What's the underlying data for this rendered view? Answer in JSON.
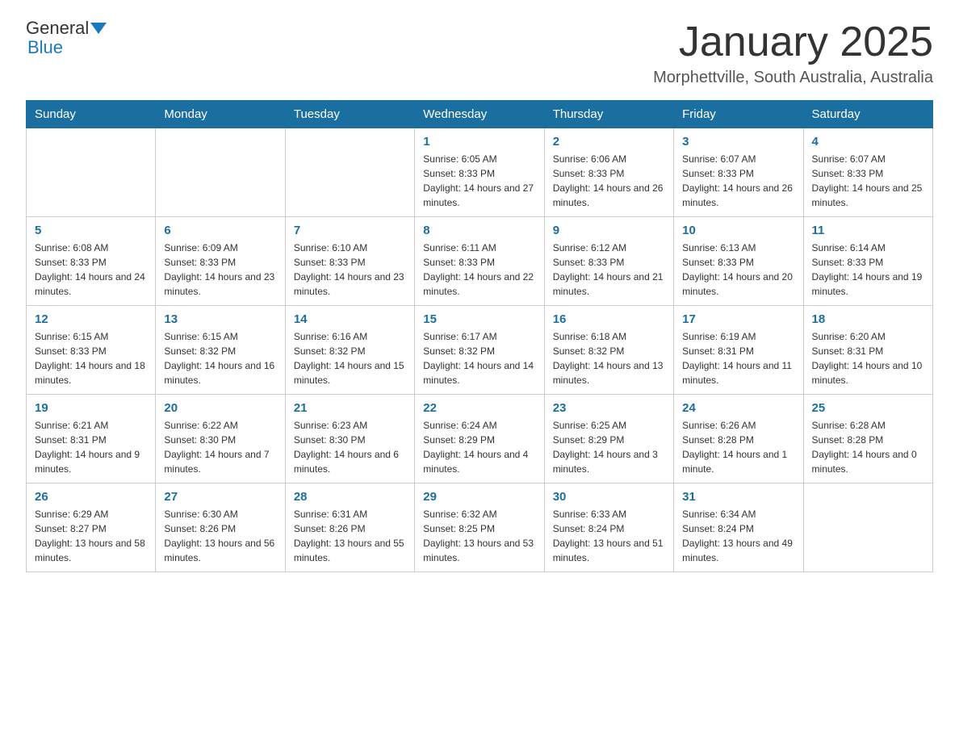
{
  "header": {
    "logo_general": "General",
    "logo_blue": "Blue",
    "month_title": "January 2025",
    "location": "Morphettville, South Australia, Australia"
  },
  "days_of_week": [
    "Sunday",
    "Monday",
    "Tuesday",
    "Wednesday",
    "Thursday",
    "Friday",
    "Saturday"
  ],
  "weeks": [
    [
      {
        "day": "",
        "info": ""
      },
      {
        "day": "",
        "info": ""
      },
      {
        "day": "",
        "info": ""
      },
      {
        "day": "1",
        "info": "Sunrise: 6:05 AM\nSunset: 8:33 PM\nDaylight: 14 hours and 27 minutes."
      },
      {
        "day": "2",
        "info": "Sunrise: 6:06 AM\nSunset: 8:33 PM\nDaylight: 14 hours and 26 minutes."
      },
      {
        "day": "3",
        "info": "Sunrise: 6:07 AM\nSunset: 8:33 PM\nDaylight: 14 hours and 26 minutes."
      },
      {
        "day": "4",
        "info": "Sunrise: 6:07 AM\nSunset: 8:33 PM\nDaylight: 14 hours and 25 minutes."
      }
    ],
    [
      {
        "day": "5",
        "info": "Sunrise: 6:08 AM\nSunset: 8:33 PM\nDaylight: 14 hours and 24 minutes."
      },
      {
        "day": "6",
        "info": "Sunrise: 6:09 AM\nSunset: 8:33 PM\nDaylight: 14 hours and 23 minutes."
      },
      {
        "day": "7",
        "info": "Sunrise: 6:10 AM\nSunset: 8:33 PM\nDaylight: 14 hours and 23 minutes."
      },
      {
        "day": "8",
        "info": "Sunrise: 6:11 AM\nSunset: 8:33 PM\nDaylight: 14 hours and 22 minutes."
      },
      {
        "day": "9",
        "info": "Sunrise: 6:12 AM\nSunset: 8:33 PM\nDaylight: 14 hours and 21 minutes."
      },
      {
        "day": "10",
        "info": "Sunrise: 6:13 AM\nSunset: 8:33 PM\nDaylight: 14 hours and 20 minutes."
      },
      {
        "day": "11",
        "info": "Sunrise: 6:14 AM\nSunset: 8:33 PM\nDaylight: 14 hours and 19 minutes."
      }
    ],
    [
      {
        "day": "12",
        "info": "Sunrise: 6:15 AM\nSunset: 8:33 PM\nDaylight: 14 hours and 18 minutes."
      },
      {
        "day": "13",
        "info": "Sunrise: 6:15 AM\nSunset: 8:32 PM\nDaylight: 14 hours and 16 minutes."
      },
      {
        "day": "14",
        "info": "Sunrise: 6:16 AM\nSunset: 8:32 PM\nDaylight: 14 hours and 15 minutes."
      },
      {
        "day": "15",
        "info": "Sunrise: 6:17 AM\nSunset: 8:32 PM\nDaylight: 14 hours and 14 minutes."
      },
      {
        "day": "16",
        "info": "Sunrise: 6:18 AM\nSunset: 8:32 PM\nDaylight: 14 hours and 13 minutes."
      },
      {
        "day": "17",
        "info": "Sunrise: 6:19 AM\nSunset: 8:31 PM\nDaylight: 14 hours and 11 minutes."
      },
      {
        "day": "18",
        "info": "Sunrise: 6:20 AM\nSunset: 8:31 PM\nDaylight: 14 hours and 10 minutes."
      }
    ],
    [
      {
        "day": "19",
        "info": "Sunrise: 6:21 AM\nSunset: 8:31 PM\nDaylight: 14 hours and 9 minutes."
      },
      {
        "day": "20",
        "info": "Sunrise: 6:22 AM\nSunset: 8:30 PM\nDaylight: 14 hours and 7 minutes."
      },
      {
        "day": "21",
        "info": "Sunrise: 6:23 AM\nSunset: 8:30 PM\nDaylight: 14 hours and 6 minutes."
      },
      {
        "day": "22",
        "info": "Sunrise: 6:24 AM\nSunset: 8:29 PM\nDaylight: 14 hours and 4 minutes."
      },
      {
        "day": "23",
        "info": "Sunrise: 6:25 AM\nSunset: 8:29 PM\nDaylight: 14 hours and 3 minutes."
      },
      {
        "day": "24",
        "info": "Sunrise: 6:26 AM\nSunset: 8:28 PM\nDaylight: 14 hours and 1 minute."
      },
      {
        "day": "25",
        "info": "Sunrise: 6:28 AM\nSunset: 8:28 PM\nDaylight: 14 hours and 0 minutes."
      }
    ],
    [
      {
        "day": "26",
        "info": "Sunrise: 6:29 AM\nSunset: 8:27 PM\nDaylight: 13 hours and 58 minutes."
      },
      {
        "day": "27",
        "info": "Sunrise: 6:30 AM\nSunset: 8:26 PM\nDaylight: 13 hours and 56 minutes."
      },
      {
        "day": "28",
        "info": "Sunrise: 6:31 AM\nSunset: 8:26 PM\nDaylight: 13 hours and 55 minutes."
      },
      {
        "day": "29",
        "info": "Sunrise: 6:32 AM\nSunset: 8:25 PM\nDaylight: 13 hours and 53 minutes."
      },
      {
        "day": "30",
        "info": "Sunrise: 6:33 AM\nSunset: 8:24 PM\nDaylight: 13 hours and 51 minutes."
      },
      {
        "day": "31",
        "info": "Sunrise: 6:34 AM\nSunset: 8:24 PM\nDaylight: 13 hours and 49 minutes."
      },
      {
        "day": "",
        "info": ""
      }
    ]
  ]
}
